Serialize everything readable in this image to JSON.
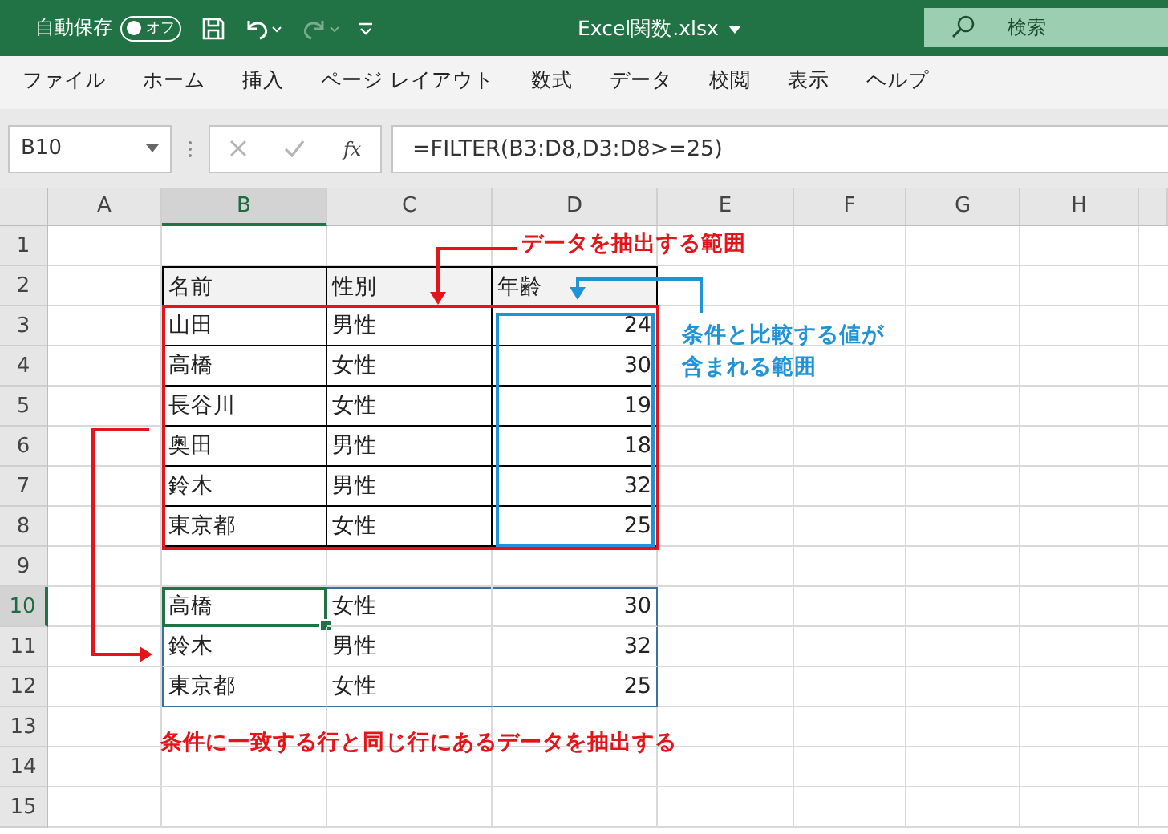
{
  "title_bar": {
    "autosave_label": "自動保存",
    "autosave_toggle": {
      "label": "オフ",
      "on": false
    },
    "quick_access": [
      {
        "kind": "save",
        "disabled": false
      },
      {
        "kind": "undo",
        "disabled": false
      },
      {
        "kind": "redo",
        "disabled": true
      },
      {
        "kind": "customize",
        "disabled": false
      }
    ],
    "file_name": "Excel関数.xlsx",
    "search": {
      "placeholder": "検索"
    }
  },
  "ribbon_tabs": [
    {
      "label": "ファイル",
      "selected": false
    },
    {
      "label": "ホーム",
      "selected": false
    },
    {
      "label": "挿入",
      "selected": false
    },
    {
      "label": "ページ レイアウト",
      "selected": false
    },
    {
      "label": "数式",
      "selected": false
    },
    {
      "label": "データ",
      "selected": false
    },
    {
      "label": "校閲",
      "selected": false
    },
    {
      "label": "表示",
      "selected": false
    },
    {
      "label": "ヘルプ",
      "selected": false
    }
  ],
  "formula_bar": {
    "name_box": "B10",
    "function_label": "fx",
    "formula": "=FILTER(B3:D8,D3:D8>=25)"
  },
  "sheet": {
    "columns": [
      {
        "label": "A",
        "selected": false
      },
      {
        "label": "B",
        "selected": true
      },
      {
        "label": "C",
        "selected": false
      },
      {
        "label": "D",
        "selected": false
      },
      {
        "label": "E",
        "selected": false
      },
      {
        "label": "F",
        "selected": false
      },
      {
        "label": "G",
        "selected": false
      },
      {
        "label": "H",
        "selected": false
      }
    ],
    "rows": [
      {
        "label": "1",
        "selected": false,
        "kind": "plain"
      },
      {
        "label": "2",
        "selected": false,
        "kind": "header",
        "cells": [
          {
            "text": "名前",
            "kind": "text",
            "selected": false
          },
          {
            "text": "性別",
            "kind": "text",
            "selected": false
          },
          {
            "text": "年齢",
            "kind": "text",
            "selected": false
          }
        ]
      },
      {
        "label": "3",
        "selected": false,
        "kind": "table",
        "cells": [
          {
            "text": "山田",
            "kind": "text",
            "selected": false
          },
          {
            "text": "男性",
            "kind": "text",
            "selected": false
          },
          {
            "text": "24",
            "kind": "number",
            "selected": false
          }
        ]
      },
      {
        "label": "4",
        "selected": false,
        "kind": "table",
        "cells": [
          {
            "text": "高橋",
            "kind": "text",
            "selected": false
          },
          {
            "text": "女性",
            "kind": "text",
            "selected": false
          },
          {
            "text": "30",
            "kind": "number",
            "selected": false
          }
        ]
      },
      {
        "label": "5",
        "selected": false,
        "kind": "table",
        "cells": [
          {
            "text": "長谷川",
            "kind": "text",
            "selected": false
          },
          {
            "text": "女性",
            "kind": "text",
            "selected": false
          },
          {
            "text": "19",
            "kind": "number",
            "selected": false
          }
        ]
      },
      {
        "label": "6",
        "selected": false,
        "kind": "table",
        "cells": [
          {
            "text": "奥田",
            "kind": "text",
            "selected": false
          },
          {
            "text": "男性",
            "kind": "text",
            "selected": false
          },
          {
            "text": "18",
            "kind": "number",
            "selected": false
          }
        ]
      },
      {
        "label": "7",
        "selected": false,
        "kind": "table",
        "cells": [
          {
            "text": "鈴木",
            "kind": "text",
            "selected": false
          },
          {
            "text": "男性",
            "kind": "text",
            "selected": false
          },
          {
            "text": "32",
            "kind": "number",
            "selected": false
          }
        ]
      },
      {
        "label": "8",
        "selected": false,
        "kind": "table",
        "cells": [
          {
            "text": "東京都",
            "kind": "text",
            "selected": false
          },
          {
            "text": "女性",
            "kind": "text",
            "selected": false
          },
          {
            "text": "25",
            "kind": "number",
            "selected": false
          }
        ]
      },
      {
        "label": "9",
        "selected": false,
        "kind": "plain"
      },
      {
        "label": "10",
        "selected": true,
        "kind": "spill",
        "cells": [
          {
            "text": "高橋",
            "kind": "text",
            "selected": true
          },
          {
            "text": "女性",
            "kind": "text",
            "selected": false
          },
          {
            "text": "30",
            "kind": "number",
            "selected": false
          }
        ]
      },
      {
        "label": "11",
        "selected": false,
        "kind": "spill",
        "cells": [
          {
            "text": "鈴木",
            "kind": "text",
            "selected": false
          },
          {
            "text": "男性",
            "kind": "text",
            "selected": false
          },
          {
            "text": "32",
            "kind": "number",
            "selected": false
          }
        ]
      },
      {
        "label": "12",
        "selected": false,
        "kind": "spill",
        "cells": [
          {
            "text": "東京都",
            "kind": "text",
            "selected": false
          },
          {
            "text": "女性",
            "kind": "text",
            "selected": false
          },
          {
            "text": "25",
            "kind": "number",
            "selected": false
          }
        ]
      },
      {
        "label": "13",
        "selected": false,
        "kind": "plain"
      },
      {
        "label": "14",
        "selected": false,
        "kind": "plain"
      },
      {
        "label": "15",
        "selected": false,
        "kind": "plain"
      }
    ]
  },
  "annotations": [
    {
      "kind": "range",
      "text": "データを抽出する範囲",
      "color": "#e3151a"
    },
    {
      "kind": "condition",
      "text": "条件と比較する値が含まれる範囲",
      "color": "#1f93d8"
    },
    {
      "kind": "result",
      "text": "条件に一致する行と同じ行にあるデータを抽出する",
      "color": "#e3151a"
    }
  ]
}
